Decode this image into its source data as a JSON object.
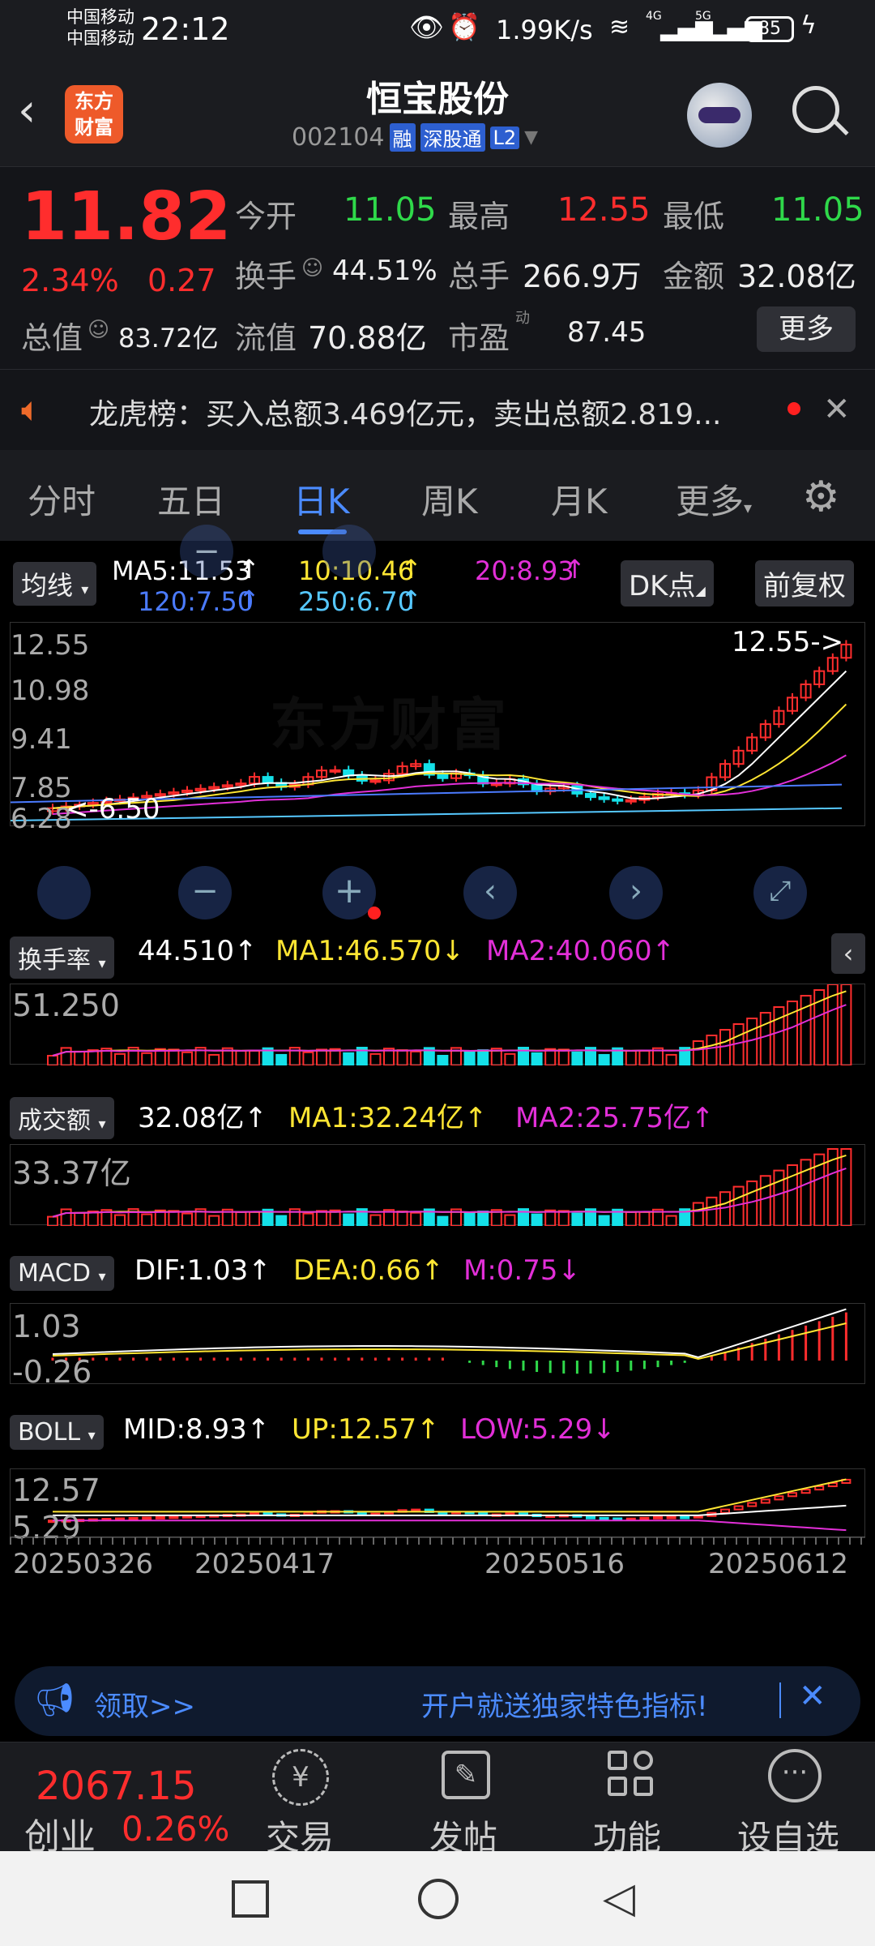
{
  "status_bar": {
    "carrier1": "中国移动",
    "carrier2": "中国移动",
    "time": "22:12",
    "speed": "1.99K/s",
    "signal1": "4G",
    "signal2": "5G",
    "battery": "85"
  },
  "header": {
    "logo_line1": "东方",
    "logo_line2": "财富",
    "title": "恒宝股份",
    "code": "002104",
    "tags": [
      "融",
      "深股通",
      "L2"
    ]
  },
  "quote": {
    "price": "11.82",
    "change_pct": "2.34%",
    "change_amt": "0.27",
    "open_label": "今开",
    "open": "11.05",
    "high_label": "最高",
    "high": "12.55",
    "low_label": "最低",
    "low": "11.05",
    "turnover_label": "换手",
    "turnover": "44.51%",
    "volume_label": "总手",
    "volume": "266.9万",
    "amount_label": "金额",
    "amount": "32.08亿",
    "mktcap_label": "总值",
    "mktcap": "83.72亿",
    "float_label": "流值",
    "float": "70.88亿",
    "pe_label": "市盈",
    "pe_sup": "动",
    "pe": "87.45",
    "more_label": "更多"
  },
  "notice": {
    "text": "龙虎榜：买入总额3.469亿元，卖出总额2.819..."
  },
  "tabs": [
    "分时",
    "五日",
    "日K",
    "周K",
    "月K",
    "更多"
  ],
  "active_tab": 2,
  "ma_bar": {
    "type_label": "均线",
    "ma5": "MA5:11.53",
    "ma10": "10:10.46",
    "ma20": "20:8.93",
    "ma120": "120:7.50",
    "ma250": "250:6.70",
    "dk_label": "DK点",
    "fq_label": "前复权"
  },
  "kline": {
    "y_ticks": [
      "12.55",
      "10.98",
      "9.41",
      "7.85",
      "6.28"
    ],
    "high_marker": "12.55->",
    "low_marker": "<-6.50",
    "watermark": "东方财富"
  },
  "turnover_panel": {
    "label": "换手率",
    "value": "44.510",
    "ma1": "MA1:46.570",
    "ma2": "MA2:40.060",
    "tick": "51.250"
  },
  "volume_panel": {
    "label": "成交额",
    "value": "32.08亿",
    "ma1": "MA1:32.24亿",
    "ma2": "MA2:25.75亿",
    "tick": "33.37亿"
  },
  "macd_panel": {
    "label": "MACD",
    "dif": "DIF:1.03",
    "dea": "DEA:0.66",
    "m": "M:0.75",
    "tick_top": "1.03",
    "tick_bottom": "-0.26"
  },
  "boll_panel": {
    "label": "BOLL",
    "mid": "MID:8.93",
    "up": "UP:12.57",
    "low": "LOW:5.29",
    "tick_top": "12.57",
    "tick_bottom": "5.29"
  },
  "dates": [
    "20250326",
    "20250417",
    "20250516",
    "20250612"
  ],
  "banner": {
    "left": "领取>>",
    "right": "开户就送独家特色指标!"
  },
  "bottom_nav": {
    "index_value": "2067.15",
    "index_name": "创业",
    "index_pct": "0.26%",
    "items": [
      "交易",
      "发帖",
      "功能",
      "设自选"
    ]
  },
  "colors": {
    "up": "#ff2d2d",
    "down": "#14e0e8",
    "ma5": "#ffffff",
    "ma10": "#ffe633",
    "ma20": "#e22fd8",
    "ma120": "#4b7bff",
    "ma250": "#56c8ff"
  },
  "chart_data": {
    "type": "candlestick",
    "dates": [
      "20250326",
      "20250417",
      "20250516",
      "20250612"
    ],
    "ylim": [
      6.28,
      12.55
    ],
    "last_close": 11.82,
    "high": 12.55,
    "low": 6.5
  }
}
